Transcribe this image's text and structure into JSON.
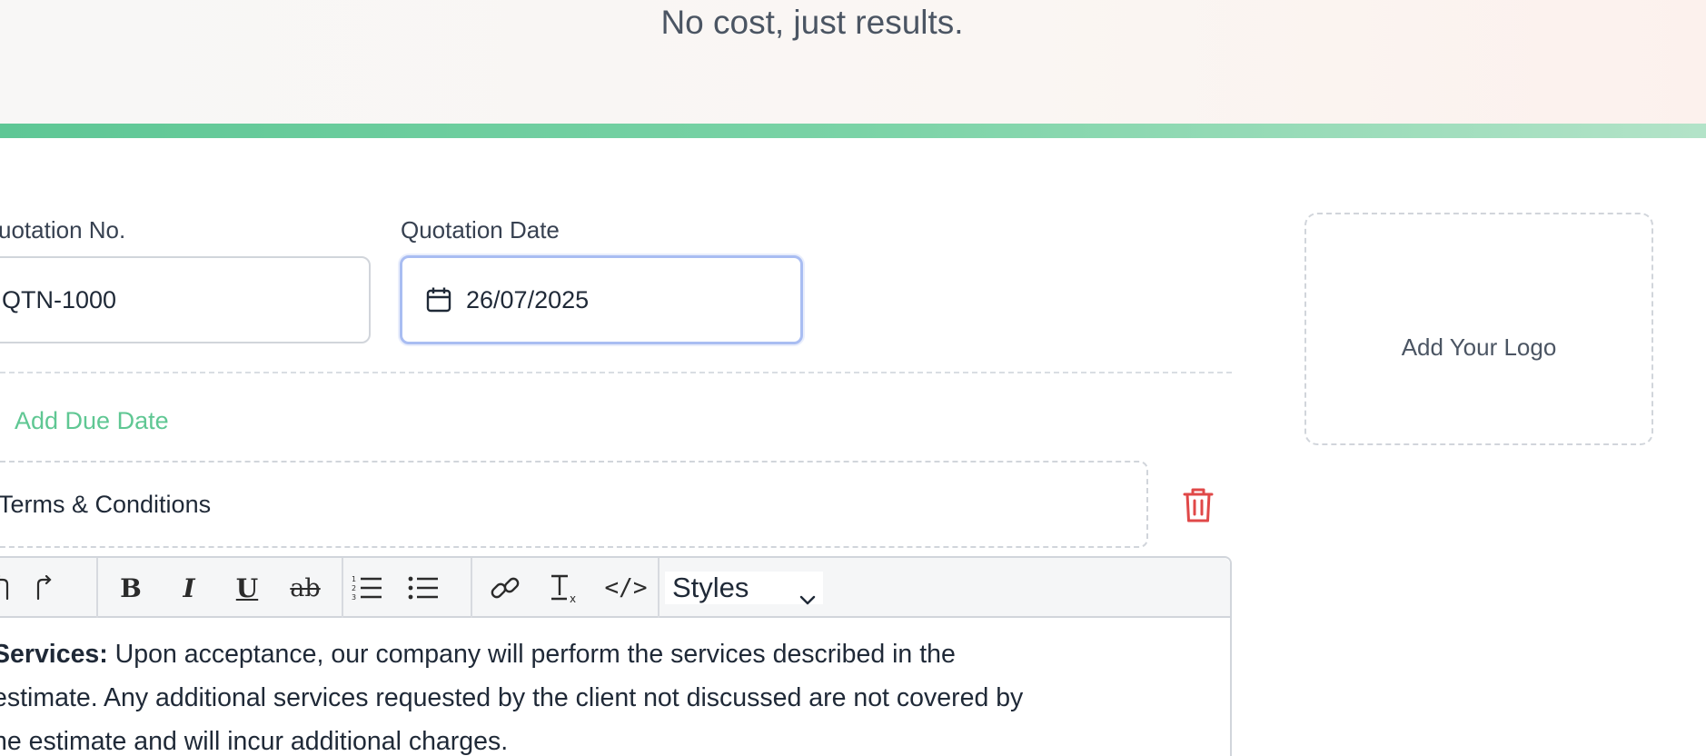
{
  "hero": {
    "tagline": "No cost, just results."
  },
  "colors": {
    "accent_green": "#5fc793",
    "focus_border": "#a9bdf2",
    "danger_red": "#e04848"
  },
  "quotation_no": {
    "label": "uotation No.",
    "value": "QTN-1000"
  },
  "quotation_date": {
    "label": "Quotation Date",
    "value": "26/07/2025",
    "icon": "calendar-icon"
  },
  "due_date": {
    "link_label": "Add Due Date"
  },
  "logo": {
    "label": "Add Your Logo"
  },
  "terms": {
    "title": "Terms & Conditions",
    "delete_icon": "trash-icon"
  },
  "editor": {
    "toolbar": {
      "undo_icon": "undo-icon",
      "redo_icon": "redo-icon",
      "bold": "B",
      "italic": "I",
      "underline": "U",
      "strike": "ab",
      "ordered_list_icon": "ordered-list-icon",
      "bullet_list_icon": "bullet-list-icon",
      "link_icon": "link-icon",
      "clear_format_icon": "clear-format-icon",
      "code": "</>",
      "styles_label": "Styles"
    },
    "content": {
      "strong": "Services:",
      "line1": " Upon acceptance, our company will perform the services described in the",
      "line2": "estimate. Any additional services requested by the client not discussed are not covered by",
      "line3": "he estimate and will incur additional charges."
    }
  }
}
